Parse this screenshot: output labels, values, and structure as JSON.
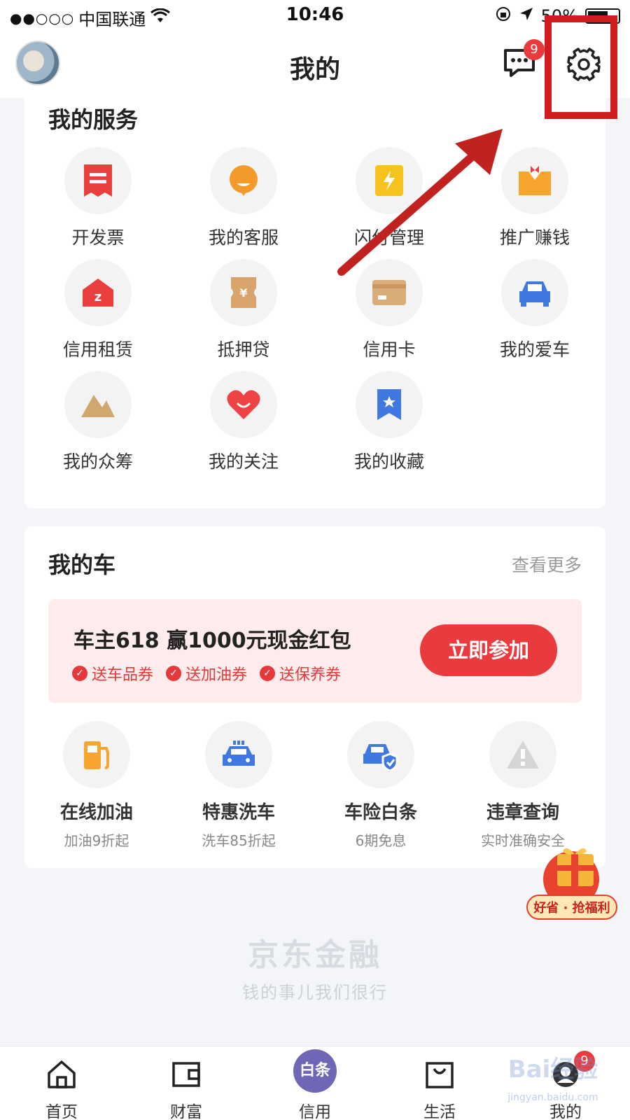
{
  "status_bar": {
    "signal": "●●○○○",
    "carrier": "中国联通",
    "time": "10:46",
    "battery": "50%"
  },
  "nav": {
    "title": "我的",
    "message_badge": "9"
  },
  "services": {
    "title": "我的服务",
    "items": [
      {
        "label": "开发票",
        "icon": "invoice-icon",
        "color": "#e9403f"
      },
      {
        "label": "我的客服",
        "icon": "customer-service-icon",
        "color": "#f39a2a"
      },
      {
        "label": "闪付管理",
        "icon": "quick-pay-icon",
        "color": "#f5c21e"
      },
      {
        "label": "推广赚钱",
        "icon": "promote-icon",
        "color": "#f7a52e"
      },
      {
        "label": "信用租赁",
        "icon": "credit-lease-icon",
        "color": "#e9403f"
      },
      {
        "label": "抵押贷",
        "icon": "mortgage-loan-icon",
        "color": "#d8a46c"
      },
      {
        "label": "信用卡",
        "icon": "credit-card-icon",
        "color": "#d8ad7a"
      },
      {
        "label": "我的爱车",
        "icon": "my-car-icon",
        "color": "#3e78e0"
      },
      {
        "label": "我的众筹",
        "icon": "crowdfunding-icon",
        "color": "#d0a86d"
      },
      {
        "label": "我的关注",
        "icon": "heart-icon",
        "color": "#ee4246"
      },
      {
        "label": "我的收藏",
        "icon": "bookmark-icon",
        "color": "#3e78e0"
      }
    ]
  },
  "car": {
    "title": "我的车",
    "see_more": "查看更多",
    "promo": {
      "title": "车主618 赢1000元现金红包",
      "tags": [
        "送车品券",
        "送加油券",
        "送保养券"
      ],
      "button": "立即参加"
    },
    "items": [
      {
        "label": "在线加油",
        "sub": "加油9折起",
        "icon": "fuel-icon",
        "color": "#f6a52f"
      },
      {
        "label": "特惠洗车",
        "sub": "洗车85折起",
        "icon": "car-wash-icon",
        "color": "#3e78e0"
      },
      {
        "label": "车险白条",
        "sub": "6期免息",
        "icon": "car-insurance-icon",
        "color": "#3e78e0"
      },
      {
        "label": "违章查询",
        "sub": "实时准确安全",
        "icon": "warning-icon",
        "color": "#d5d5d5"
      }
    ]
  },
  "floating_gift": {
    "label": "好省 · 抢福利"
  },
  "footer": {
    "brand": "京东金融",
    "slogan": "钱的事儿我们很行"
  },
  "tab_bar": {
    "tabs": [
      {
        "label": "首页"
      },
      {
        "label": "财富"
      },
      {
        "label": "信用",
        "icon_text": "白条"
      },
      {
        "label": "生活"
      },
      {
        "label": "我的",
        "badge": "9"
      }
    ]
  },
  "watermark": {
    "text": "Bai经验",
    "sub": "jingyan.baidu.com"
  }
}
